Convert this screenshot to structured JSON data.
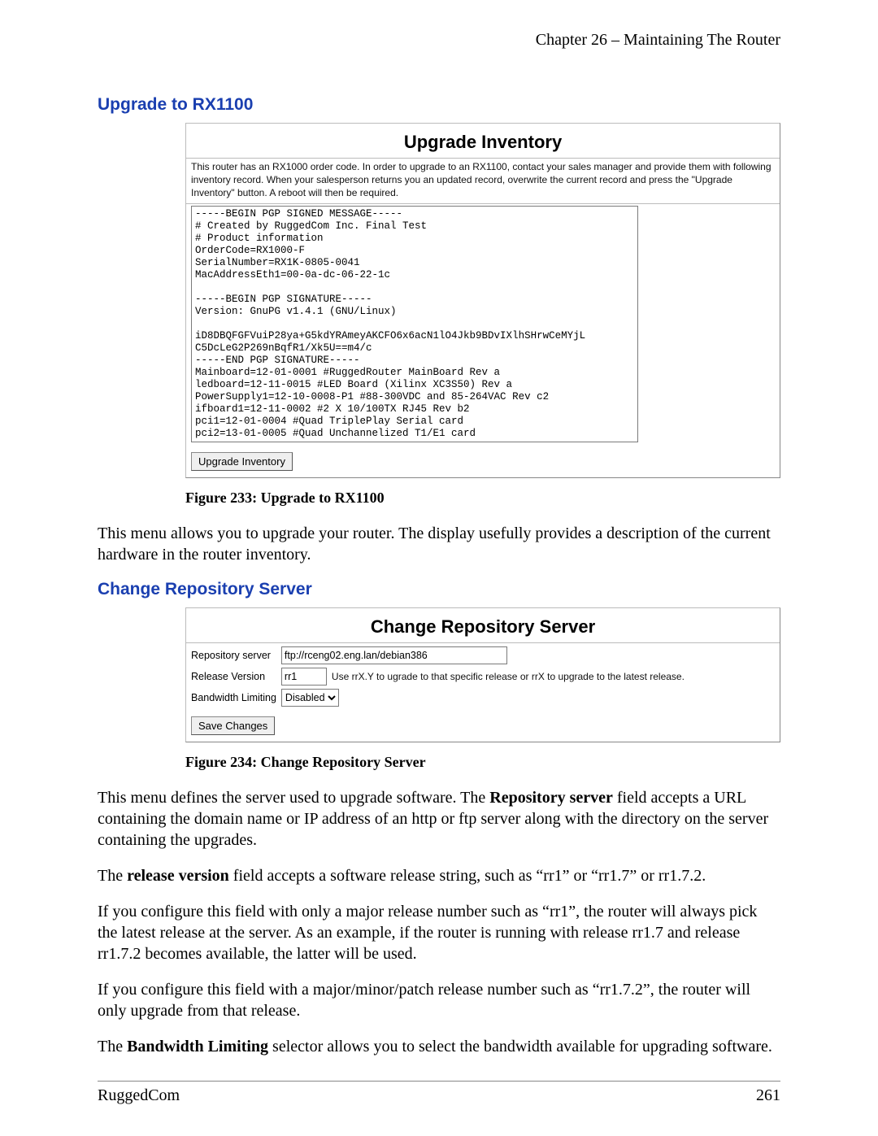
{
  "chapter_header": "Chapter 26 – Maintaining The Router",
  "section1": {
    "title": "Upgrade to RX1100",
    "panel_title": "Upgrade Inventory",
    "panel_desc": "This router has an RX1000 order code. In order to upgrade to an RX1100, contact your sales manager and provide them with following inventory record. When your salesperson returns you an updated record, overwrite the current record and press the \"Upgrade Inventory\" button. A reboot will then be required.",
    "textarea": "-----BEGIN PGP SIGNED MESSAGE-----\n# Created by RuggedCom Inc. Final Test\n# Product information\nOrderCode=RX1000-F\nSerialNumber=RX1K-0805-0041\nMacAddressEth1=00-0a-dc-06-22-1c\n\n-----BEGIN PGP SIGNATURE-----\nVersion: GnuPG v1.4.1 (GNU/Linux)\n\niD8DBQFGFVuiP28ya+G5kdYRAmeyAKCFO6x6acN1lO4Jkb9BDvIXlhSHrwCeMYjL\nC5DcLeG2P269nBqfR1/Xk5U==m4/c\n-----END PGP SIGNATURE-----\nMainboard=12-01-0001 #RuggedRouter MainBoard Rev a\nledboard=12-11-0015 #LED Board (Xilinx XC3S50) Rev a\nPowerSupply1=12-10-0008-P1 #88-300VDC and 85-264VAC Rev c2\nifboard1=12-11-0002 #2 X 10/100TX RJ45 Rev b2\npci1=12-01-0004 #Quad TriplePlay Serial card\npci2=13-01-0005 #Quad Unchannelized T1/E1 card",
    "button": "Upgrade Inventory",
    "caption": "Figure 233: Upgrade to RX1100",
    "body_p1": "This menu allows you to upgrade your router.  The display usefully provides a description of the current hardware in the router inventory."
  },
  "section2": {
    "title": "Change Repository Server",
    "panel_title": "Change Repository Server",
    "rows": {
      "row1_label": "Repository server",
      "row1_value": "ftp://rceng02.eng.lan/debian386",
      "row2_label": "Release Version",
      "row2_value": "rr1",
      "row2_hint": "Use rrX.Y to ugrade to that specific release or rrX to upgrade to the latest release.",
      "row3_label": "Bandwidth Limiting",
      "row3_value": "Disabled"
    },
    "button": "Save Changes",
    "caption": "Figure 234: Change Repository Server",
    "p1_a": "This menu defines the server used to upgrade software.  The ",
    "p1_b": "Repository server",
    "p1_c": " field accepts a URL containing the domain name or IP address of an http or ftp server along with the directory on the server containing the upgrades.",
    "p2_a": "The ",
    "p2_b": "release version",
    "p2_c": " field accepts a software release string, such as “rr1” or “rr1.7” or rr1.7.2.",
    "p3": "If you configure this field with only a major release number such as “rr1”, the router will always pick the latest release at the server.  As an example, if the router is running with release rr1.7 and release rr1.7.2 becomes available, the latter will be used.",
    "p4": "If you configure this field with a major/minor/patch release number such as “rr1.7.2”, the router will only upgrade from that release.",
    "p5_a": "The ",
    "p5_b": "Bandwidth Limiting",
    "p5_c": " selector allows you to select the bandwidth available for upgrading software."
  },
  "footer": {
    "left": "RuggedCom",
    "right": "261"
  }
}
